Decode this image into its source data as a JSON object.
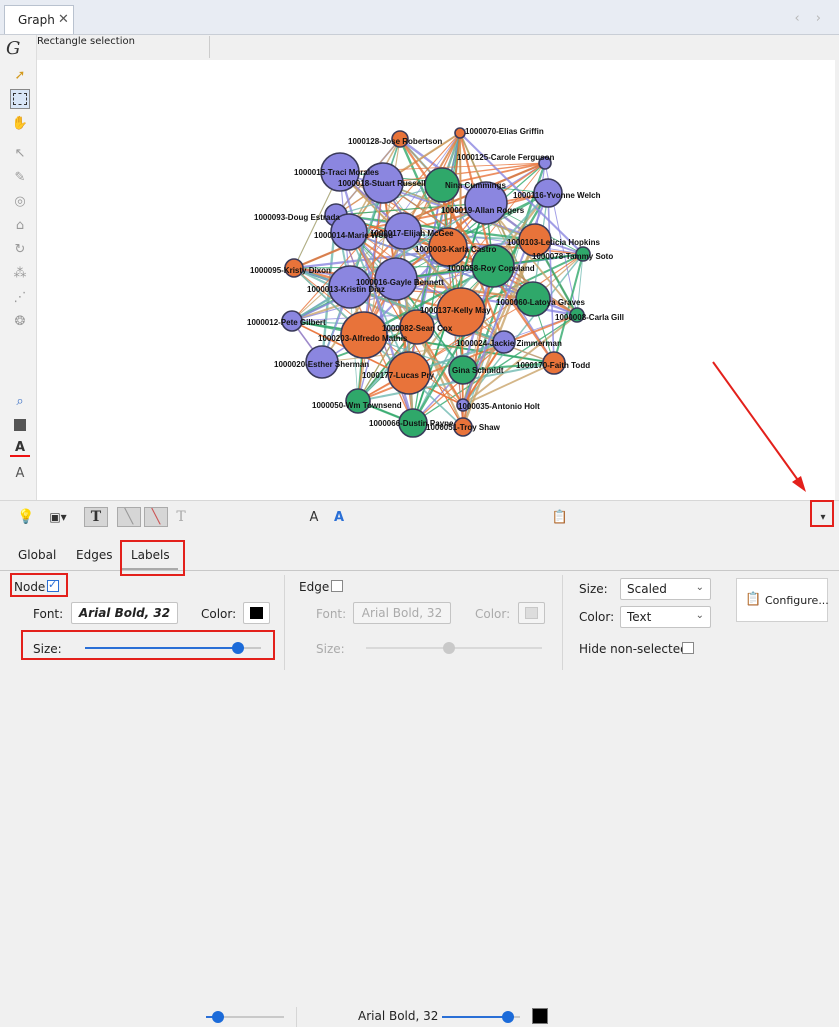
{
  "window": {
    "tab_title": "Graph",
    "close_glyph": "✕",
    "nav": "‹ ›"
  },
  "mode": {
    "label": "Rectangle selection"
  },
  "graph": {
    "nodes": [
      {
        "label": "1000070-Elias Griffin",
        "color": "#e8733a"
      },
      {
        "label": "1000128-Jose Robertson",
        "color": "#e8733a"
      },
      {
        "label": "1000125-Carole Ferguson",
        "color": "#8b86e0"
      },
      {
        "label": "1000015-Traci Morales",
        "color": "#8b86e0"
      },
      {
        "label": "1000018-Stuart Russell",
        "color": "#8b86e0"
      },
      {
        "label": "Nina Cummings",
        "color": "#2fa86a"
      },
      {
        "label": "1000116-Yvonne Welch",
        "color": "#8b86e0"
      },
      {
        "label": "1000019-Allan Rogers",
        "color": "#8b86e0"
      },
      {
        "label": "1000093-Doug Estrada",
        "color": "#8b86e0"
      },
      {
        "label": "1000014-Marie Wood",
        "color": "#8b86e0"
      },
      {
        "label": "1000017-Elijah McGee",
        "color": "#8b86e0"
      },
      {
        "label": "1000003-Karla Castro",
        "color": "#e8733a"
      },
      {
        "label": "1000103-Leticia Hopkins",
        "color": "#e8733a"
      },
      {
        "label": "1000078-Tammy Soto",
        "color": "#2fa86a"
      },
      {
        "label": "1000095-Kristy Dixon",
        "color": "#e8733a"
      },
      {
        "label": "1000058-Roy Copeland",
        "color": "#2fa86a"
      },
      {
        "label": "1000013-Kristin Diaz",
        "color": "#8b86e0"
      },
      {
        "label": "1000016-Gayle Bennett",
        "color": "#8b86e0"
      },
      {
        "label": "1000060-Latoya Graves",
        "color": "#2fa86a"
      },
      {
        "label": "1000137-Kelly May",
        "color": "#e8733a"
      },
      {
        "label": "1000008-Carla Gill",
        "color": "#2fa86a"
      },
      {
        "label": "1000012-Pete Gilbert",
        "color": "#8b86e0"
      },
      {
        "label": "1000082-Sean Cox",
        "color": "#e8733a"
      },
      {
        "label": "1000203-Alfredo Mathis",
        "color": "#e8733a"
      },
      {
        "label": "1000024-Jackie Zimmerman",
        "color": "#8b86e0"
      },
      {
        "label": "1000020-Esther Sherman",
        "color": "#8b86e0"
      },
      {
        "label": "1000177-Lucas Pry",
        "color": "#e8733a"
      },
      {
        "label": "Gina Schmidt",
        "color": "#2fa86a"
      },
      {
        "label": "1000170-Faith Todd",
        "color": "#e8733a"
      },
      {
        "label": "1000050-Wm Townsend",
        "color": "#2fa86a"
      },
      {
        "label": "1000035-Antonio Holt",
        "color": "#8b86e0"
      },
      {
        "label": "1000066-Dustin Payne",
        "color": "#2fa86a"
      },
      {
        "label": "1000051-Troy Shaw",
        "color": "#e8733a"
      }
    ],
    "edge_colors": [
      "#e8733a",
      "#2fa86a",
      "#8b86e0",
      "#c9a46a",
      "#6fb9b0"
    ]
  },
  "bottom_toolbar": {
    "font_label": "Arial Bold, 32",
    "font_a_glyph": "A",
    "color_swatch": "#000000"
  },
  "panel": {
    "tabs": [
      "Global",
      "Edges",
      "Labels"
    ],
    "node": {
      "label": "Node",
      "checked": true,
      "check_glyph": "✓",
      "font_label": "Font:",
      "font_value": "Arial Bold, 32",
      "color_label": "Color:",
      "color_value": "#000000",
      "size_label": "Size:",
      "size_value": 0.87
    },
    "edge": {
      "label": "Edge",
      "checked": false,
      "font_label": "Font:",
      "font_value": "Arial Bold, 32",
      "color_label": "Color:",
      "size_label": "Size:",
      "size_value": 0.47
    },
    "right": {
      "size_label": "Size:",
      "size_value": "Scaled",
      "color_label": "Color:",
      "color_value": "Text",
      "hide_label": "Hide non-selected",
      "configure_label": "Configure..."
    }
  }
}
